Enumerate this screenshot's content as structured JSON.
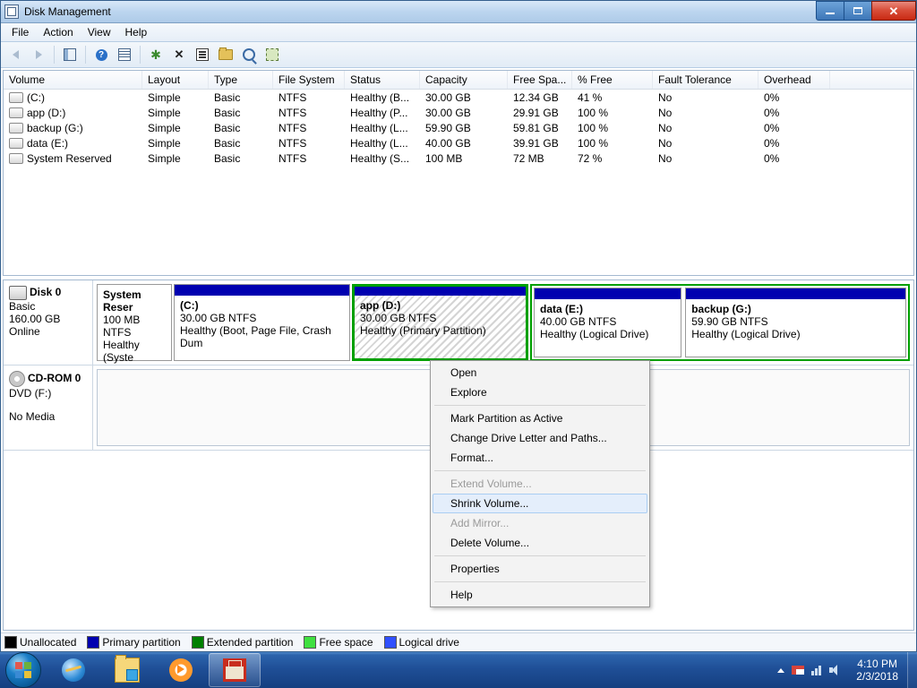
{
  "window": {
    "title": "Disk Management"
  },
  "menu": {
    "file": "File",
    "action": "Action",
    "view": "View",
    "help": "Help"
  },
  "columns": {
    "volume": "Volume",
    "layout": "Layout",
    "type": "Type",
    "fs": "File System",
    "status": "Status",
    "capacity": "Capacity",
    "free": "Free Spa...",
    "pct": "% Free",
    "fault": "Fault Tolerance",
    "overhead": "Overhead"
  },
  "volumes": [
    {
      "name": "(C:)",
      "layout": "Simple",
      "type": "Basic",
      "fs": "NTFS",
      "status": "Healthy (B...",
      "cap": "30.00 GB",
      "free": "12.34 GB",
      "pct": "41 %",
      "fault": "No",
      "ovh": "0%"
    },
    {
      "name": "app (D:)",
      "layout": "Simple",
      "type": "Basic",
      "fs": "NTFS",
      "status": "Healthy (P...",
      "cap": "30.00 GB",
      "free": "29.91 GB",
      "pct": "100 %",
      "fault": "No",
      "ovh": "0%"
    },
    {
      "name": "backup (G:)",
      "layout": "Simple",
      "type": "Basic",
      "fs": "NTFS",
      "status": "Healthy (L...",
      "cap": "59.90 GB",
      "free": "59.81 GB",
      "pct": "100 %",
      "fault": "No",
      "ovh": "0%"
    },
    {
      "name": "data (E:)",
      "layout": "Simple",
      "type": "Basic",
      "fs": "NTFS",
      "status": "Healthy (L...",
      "cap": "40.00 GB",
      "free": "39.91 GB",
      "pct": "100 %",
      "fault": "No",
      "ovh": "0%"
    },
    {
      "name": "System Reserved",
      "layout": "Simple",
      "type": "Basic",
      "fs": "NTFS",
      "status": "Healthy (S...",
      "cap": "100 MB",
      "free": "72 MB",
      "pct": "72 %",
      "fault": "No",
      "ovh": "0%"
    }
  ],
  "disk0": {
    "title": "Disk 0",
    "type": "Basic",
    "size": "160.00 GB",
    "state": "Online",
    "parts": {
      "sysres": {
        "name": "System Reser",
        "size": "100 MB NTFS",
        "status": "Healthy (Syste"
      },
      "c": {
        "name": "(C:)",
        "size": "30.00 GB NTFS",
        "status": "Healthy (Boot, Page File, Crash Dum"
      },
      "d": {
        "name": "app  (D:)",
        "size": "30.00 GB NTFS",
        "status": "Healthy (Primary Partition)"
      },
      "e": {
        "name": "data  (E:)",
        "size": "40.00 GB NTFS",
        "status": "Healthy (Logical Drive)"
      },
      "g": {
        "name": "backup  (G:)",
        "size": "59.90 GB NTFS",
        "status": "Healthy (Logical Drive)"
      }
    }
  },
  "cdrom": {
    "title": "CD-ROM 0",
    "type": "DVD (F:)",
    "state": "No Media"
  },
  "legend": {
    "unalloc": "Unallocated",
    "primary": "Primary partition",
    "extended": "Extended partition",
    "free": "Free space",
    "logical": "Logical drive"
  },
  "context": {
    "open": "Open",
    "explore": "Explore",
    "mark": "Mark Partition as Active",
    "change": "Change Drive Letter and Paths...",
    "format": "Format...",
    "extend": "Extend Volume...",
    "shrink": "Shrink Volume...",
    "mirror": "Add Mirror...",
    "delete": "Delete Volume...",
    "props": "Properties",
    "help": "Help"
  },
  "tray": {
    "time": "4:10 PM",
    "date": "2/3/2018"
  }
}
